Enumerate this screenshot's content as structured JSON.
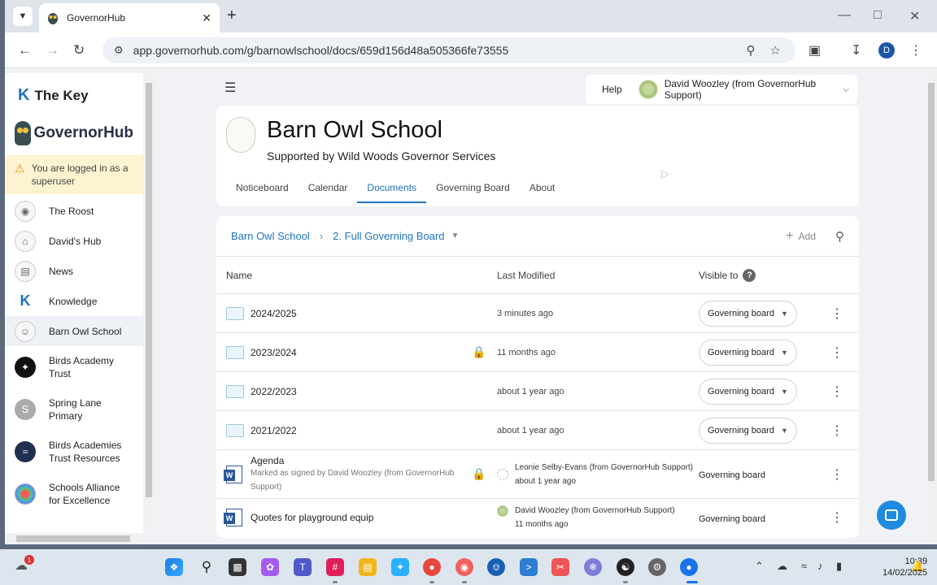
{
  "browser": {
    "tab_title": "GovernorHub",
    "url": "app.governorhub.com/g/barnowlschool/docs/659d156d48a505366fe73555",
    "profile_initial": "D"
  },
  "sidebar": {
    "brand_key": "The Key",
    "brand_app": "GovernorHub",
    "warning": "You are logged in as a superuser",
    "items": [
      {
        "label": "The Roost"
      },
      {
        "label": "David's Hub"
      },
      {
        "label": "News"
      },
      {
        "label": "Knowledge"
      },
      {
        "label": "Barn Owl School"
      },
      {
        "label": "Birds Academy Trust"
      },
      {
        "label": "Spring Lane Primary",
        "initial": "S"
      },
      {
        "label": "Birds Academies Trust Resources"
      },
      {
        "label": "Schools Alliance for Excellence"
      }
    ]
  },
  "header": {
    "help": "Help",
    "user": "David Woozley (from GovernorHub Support)"
  },
  "school": {
    "name": "Barn Owl School",
    "subtitle": "Supported by Wild Woods Governor Services",
    "tabs": [
      "Noticeboard",
      "Calendar",
      "Documents",
      "Governing Board",
      "About"
    ],
    "active_tab": "Documents"
  },
  "docs": {
    "breadcrumb_root": "Barn Owl School",
    "breadcrumb_current": "2. Full Governing Board",
    "add_label": "Add",
    "columns": {
      "name": "Name",
      "modified": "Last Modified",
      "visible": "Visible to",
      "help": "?"
    },
    "rows": [
      {
        "name": "2024/2025",
        "modified": "3 minutes ago",
        "visible": "Governing board"
      },
      {
        "name": "2023/2024",
        "modified": "11 months ago",
        "visible": "Governing board"
      },
      {
        "name": "2022/2023",
        "modified": "about 1 year ago",
        "visible": "Governing board"
      },
      {
        "name": "2021/2022",
        "modified": "about 1 year ago",
        "visible": "Governing board"
      }
    ],
    "files": [
      {
        "name": "Agenda",
        "sub": "Marked as signed by David Woozley (from GovernorHub Support)",
        "modified_by": "Leonie Selby-Evans (from GovernorHub Support)",
        "modified": "about 1 year ago",
        "visible": "Governing board"
      },
      {
        "name": "Quotes for playground equip",
        "modified_by": "David Woozley (from GovernorHub Support)",
        "modified": "11 months ago",
        "visible": "Governing board"
      }
    ]
  },
  "taskbar": {
    "notification_count": "1",
    "time": "10:39",
    "date": "14/02/2025"
  }
}
